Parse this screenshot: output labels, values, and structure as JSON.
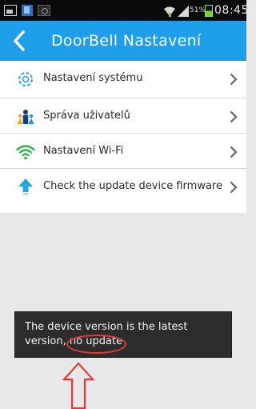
{
  "status_bar": {
    "battery_text": "51%",
    "battery_level": 0.51,
    "time": "08:45",
    "icons": [
      "gallery-icon",
      "app-icon",
      "photo-icon",
      "wifi-icon",
      "signal-icon",
      "battery-icon"
    ]
  },
  "header": {
    "title": "DoorBell Nastavení",
    "background_color": "#1f9ee9",
    "back_icon": "chevron-left-icon"
  },
  "menu": {
    "items": [
      {
        "label": "Nastavení systému",
        "icon": "gear-icon"
      },
      {
        "label": "Správa uživatelů",
        "icon": "users-icon"
      },
      {
        "label": "Nastavení Wi-Fi",
        "icon": "wifi-icon"
      },
      {
        "label": "Check the update device firmware",
        "icon": "upload-arrow-icon"
      }
    ],
    "chevron_icon": "chevron-right-icon"
  },
  "toast": {
    "message_line1": "The device version is the latest",
    "message_line2_prefix": "version,",
    "message_line2_highlight": "no update"
  },
  "annotations": {
    "highlight_color": "#e53a3a",
    "arrow_icon": "up-arrow-outline-icon"
  }
}
